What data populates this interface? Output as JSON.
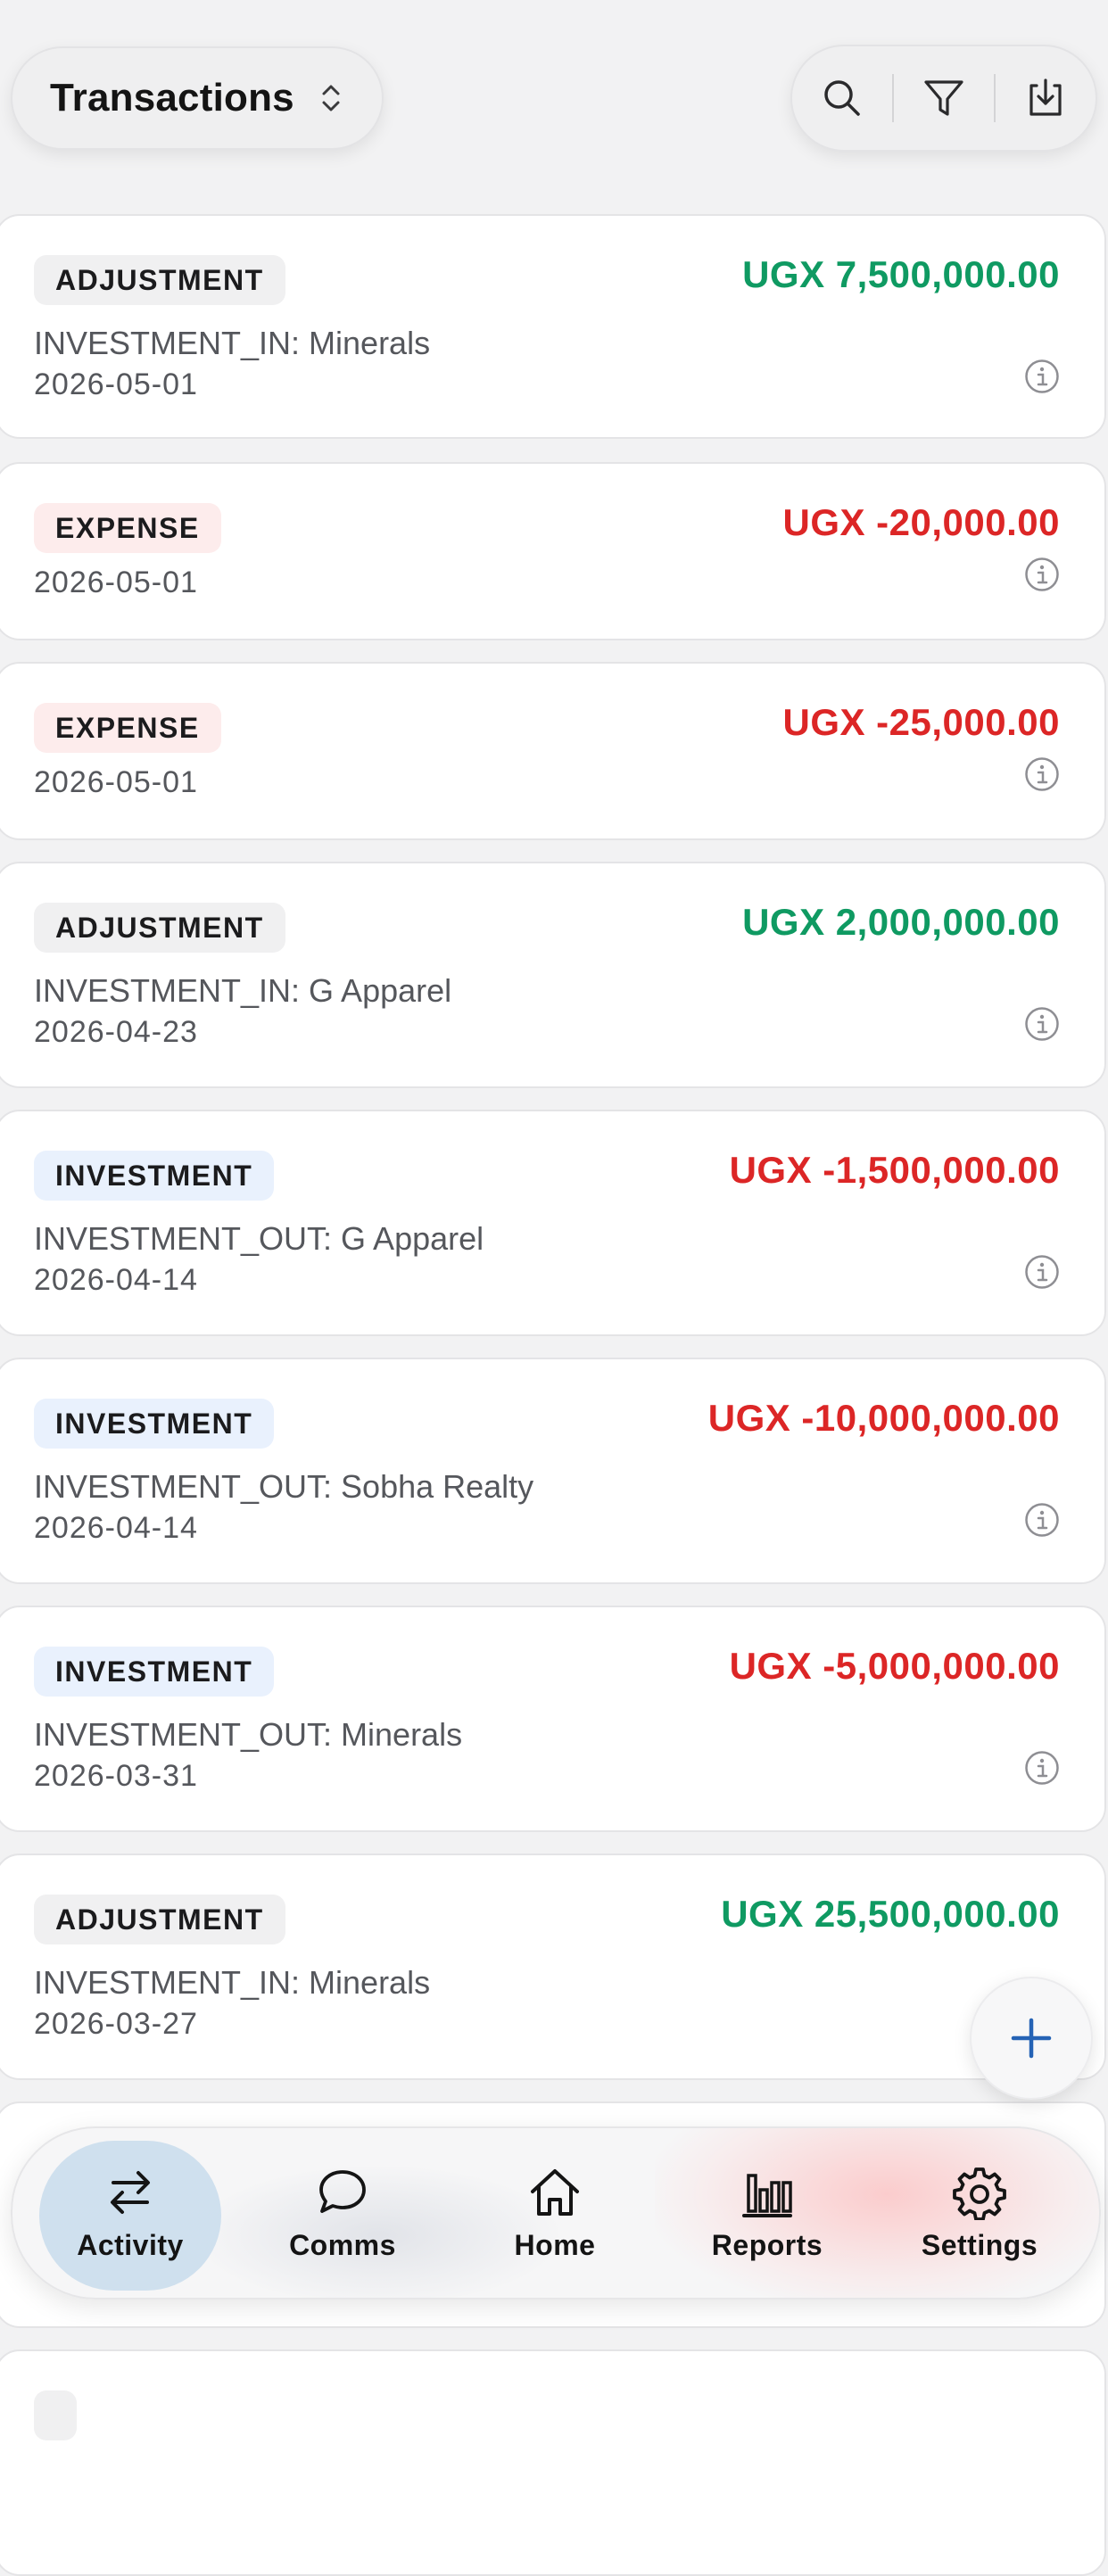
{
  "header": {
    "title": "Transactions",
    "sort_icon": "chevron-up-down-icon",
    "actions": [
      {
        "name": "search",
        "icon": "search-icon"
      },
      {
        "name": "filter",
        "icon": "filter-icon"
      },
      {
        "name": "export",
        "icon": "download-icon"
      }
    ]
  },
  "transactions": [
    {
      "type": "ADJUSTMENT",
      "amount": "UGX 7,500,000.00",
      "sign": "pos",
      "description": "INVESTMENT_IN: Minerals",
      "date": "2026-05-01"
    },
    {
      "type": "EXPENSE",
      "amount": "UGX -20,000.00",
      "sign": "neg",
      "description": "",
      "date": "2026-05-01"
    },
    {
      "type": "EXPENSE",
      "amount": "UGX -25,000.00",
      "sign": "neg",
      "description": "",
      "date": "2026-05-01"
    },
    {
      "type": "ADJUSTMENT",
      "amount": "UGX 2,000,000.00",
      "sign": "pos",
      "description": "INVESTMENT_IN: G Apparel",
      "date": "2026-04-23"
    },
    {
      "type": "INVESTMENT",
      "amount": "UGX -1,500,000.00",
      "sign": "neg",
      "description": "INVESTMENT_OUT: G Apparel",
      "date": "2026-04-14"
    },
    {
      "type": "INVESTMENT",
      "amount": "UGX -10,000,000.00",
      "sign": "neg",
      "description": "INVESTMENT_OUT: Sobha Realty",
      "date": "2026-04-14"
    },
    {
      "type": "INVESTMENT",
      "amount": "UGX -5,000,000.00",
      "sign": "neg",
      "description": "INVESTMENT_OUT: Minerals",
      "date": "2026-03-31"
    },
    {
      "type": "ADJUSTMENT",
      "amount": "UGX 25,500,000.00",
      "sign": "pos",
      "description": "INVESTMENT_IN: Minerals",
      "date": "2026-03-27"
    }
  ],
  "fab": {
    "icon": "plus-icon"
  },
  "nav": {
    "active": "Activity",
    "items": [
      {
        "label": "Activity",
        "icon": "arrows-exchange-icon"
      },
      {
        "label": "Comms",
        "icon": "chat-bubble-icon"
      },
      {
        "label": "Home",
        "icon": "home-icon"
      },
      {
        "label": "Reports",
        "icon": "bar-chart-icon"
      },
      {
        "label": "Settings",
        "icon": "gear-icon"
      }
    ]
  },
  "colors": {
    "positive": "#0f9a62",
    "negative": "#dc2626",
    "nav_active_bg": "#cfe0ee",
    "fab_plus": "#2563b5"
  }
}
